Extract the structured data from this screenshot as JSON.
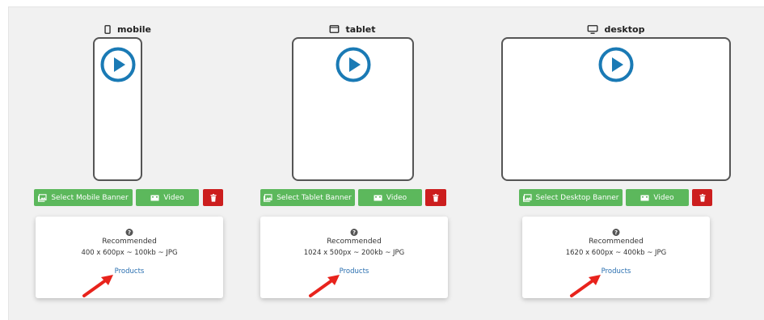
{
  "devices": [
    {
      "title": "mobile",
      "icon": "mobile-icon",
      "select_label": "Select Mobile Banner",
      "video_label": "Video",
      "recommended_label": "Recommended",
      "spec": "400 x 600px ~ 100kb ~ JPG",
      "link": "Products"
    },
    {
      "title": "tablet",
      "icon": "tablet-icon",
      "select_label": "Select Tablet Banner",
      "video_label": "Video",
      "recommended_label": "Recommended",
      "spec": "1024 x 500px ~ 200kb ~ JPG",
      "link": "Products"
    },
    {
      "title": "desktop",
      "icon": "desktop-icon",
      "select_label": "Select Desktop Banner",
      "video_label": "Video",
      "recommended_label": "Recommended",
      "spec": "1620 x 600px ~ 400kb ~ JPG",
      "link": "Products"
    }
  ],
  "colors": {
    "panel_bg": "#f1f1f1",
    "play_blue": "#1a7ab5",
    "button_green": "#5cb85c",
    "button_red": "#cc1e1e",
    "link_blue": "#2a6fb0",
    "annotation_arrow": "#e8231c"
  },
  "icons": {
    "play": "play-circle-icon",
    "image": "image-icon",
    "video": "video-icon",
    "delete": "trash-icon",
    "help": "question-circle-icon"
  }
}
